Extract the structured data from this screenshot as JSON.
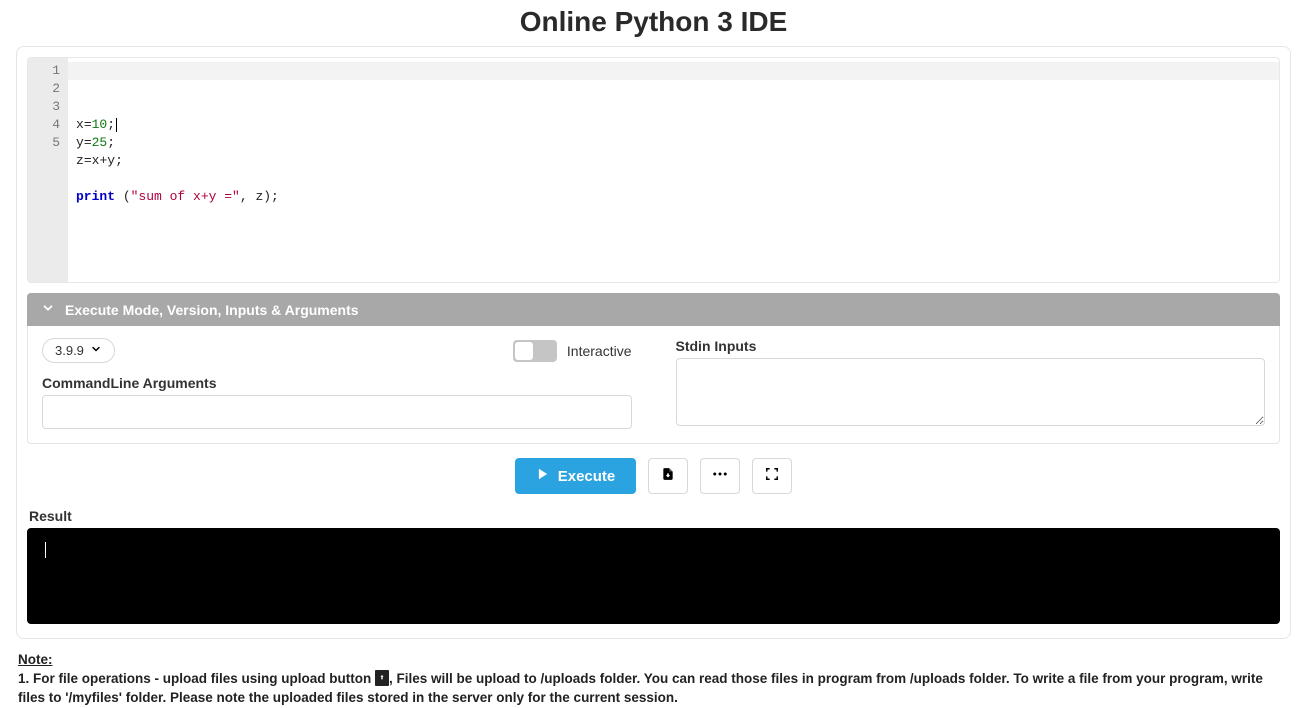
{
  "title": "Online Python 3 IDE",
  "editor": {
    "line_numbers": [
      "1",
      "2",
      "3",
      "4",
      "5"
    ],
    "lines": [
      {
        "tokens": [
          {
            "t": "x",
            "c": "var"
          },
          {
            "t": "=",
            "c": "op"
          },
          {
            "t": "10",
            "c": "num"
          },
          {
            "t": ";",
            "c": "op"
          },
          {
            "t": "",
            "c": "cursor"
          }
        ]
      },
      {
        "tokens": [
          {
            "t": "y",
            "c": "var"
          },
          {
            "t": "=",
            "c": "op"
          },
          {
            "t": "25",
            "c": "num"
          },
          {
            "t": ";",
            "c": "op"
          }
        ]
      },
      {
        "tokens": [
          {
            "t": "z",
            "c": "var"
          },
          {
            "t": "=",
            "c": "op"
          },
          {
            "t": "x",
            "c": "var"
          },
          {
            "t": "+",
            "c": "op"
          },
          {
            "t": "y",
            "c": "var"
          },
          {
            "t": ";",
            "c": "op"
          }
        ]
      },
      {
        "tokens": []
      },
      {
        "tokens": [
          {
            "t": "print",
            "c": "kw"
          },
          {
            "t": " (",
            "c": "op"
          },
          {
            "t": "\"sum of x+y =\"",
            "c": "str"
          },
          {
            "t": ", z);",
            "c": "op"
          }
        ]
      }
    ]
  },
  "options": {
    "header": "Execute Mode, Version, Inputs & Arguments",
    "version": "3.9.9",
    "interactive_label": "Interactive",
    "cmdline_label": "CommandLine Arguments",
    "cmdline_value": "",
    "stdin_label": "Stdin Inputs",
    "stdin_value": ""
  },
  "actions": {
    "execute": "Execute"
  },
  "result": {
    "label": "Result",
    "output": ""
  },
  "notes": {
    "heading": "Note:",
    "item1_a": "1. For file operations - upload files using upload button ",
    "item1_b": ", Files will be upload to /uploads folder. You can read those files in program from /uploads folder. To write a file from your program, write files to '/myfiles' folder. Please note the uploaded files stored in the server only for the current session."
  }
}
